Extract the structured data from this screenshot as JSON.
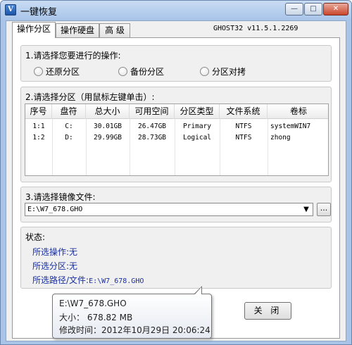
{
  "window": {
    "title": "一键恢复"
  },
  "title_buttons": {
    "minimize": "—",
    "maximize": "□",
    "close": "✕"
  },
  "tabs": [
    {
      "label": "操作分区",
      "active": true
    },
    {
      "label": "操作硬盘",
      "active": false
    },
    {
      "label": "高 级",
      "active": false
    }
  ],
  "version": "GHOST32 v11.5.1.2269",
  "operation": {
    "label": "1.请选择您要进行的操作:",
    "options": [
      "还原分区",
      "备份分区",
      "分区对拷"
    ]
  },
  "partition": {
    "label": "2.请选择分区（用鼠标左键单击）:",
    "columns": [
      "序号",
      "盘符",
      "总大小",
      "可用空间",
      "分区类型",
      "文件系统",
      "卷标"
    ],
    "rows": [
      [
        "1:1",
        "C:",
        "30.01GB",
        "26.47GB",
        "Primary",
        "NTFS",
        "systemWIN7"
      ],
      [
        "1:2",
        "D:",
        "29.99GB",
        "28.73GB",
        "Logical",
        "NTFS",
        "zhong"
      ]
    ]
  },
  "image_file": {
    "label": "3.请选择镜像文件:",
    "value": "E:\\W7_678.GHO",
    "browse_label": "..."
  },
  "status": {
    "label": "状态:",
    "op_label": "所选操作:",
    "op_value": "无",
    "part_label": "所选分区:",
    "part_value": "无",
    "path_label": "所选路径/文件:",
    "path_value": "E:\\W7_678.GHO"
  },
  "close_button": "关 闭",
  "tooltip": {
    "path": "E:\\W7_678.GHO",
    "size": "大小： 678.82 MB",
    "modified": "修改时间：2012年10月29日 20:06:24"
  },
  "colors": {
    "status_text": "#1a2fa0",
    "title_bar": "#aac6ea"
  }
}
